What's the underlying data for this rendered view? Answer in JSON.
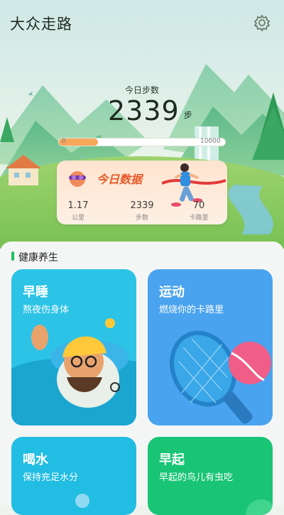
{
  "app": {
    "title": "大众走路"
  },
  "steps": {
    "label": "今日步数",
    "value": "2339",
    "unit": "步",
    "progress_min": "0",
    "progress_max": "10000",
    "progress_fraction": 0.2339
  },
  "today": {
    "title": "今日数据",
    "stats": [
      {
        "value": "1.17",
        "label": "公里"
      },
      {
        "value": "2339",
        "label": "步数"
      },
      {
        "value": "70",
        "label": "卡路里"
      }
    ]
  },
  "health": {
    "section_title": "健康养生",
    "cards": [
      {
        "title": "早睡",
        "subtitle": "熬夜伤身体",
        "color": "#2cc3e6"
      },
      {
        "title": "运动",
        "subtitle": "燃烧你的卡路里",
        "color": "#4aa3ee"
      },
      {
        "title": "喝水",
        "subtitle": "保持充足水分",
        "color": "#22bde2"
      },
      {
        "title": "早起",
        "subtitle": "早起的鸟儿有虫吃",
        "color": "#19c575"
      }
    ]
  },
  "icons": [
    "gear-icon",
    "runner-illustration",
    "avatar-icon",
    "sleep-illustration",
    "tennis-racket-illustration",
    "water-drop-illustration",
    "sunrise-illustration"
  ]
}
